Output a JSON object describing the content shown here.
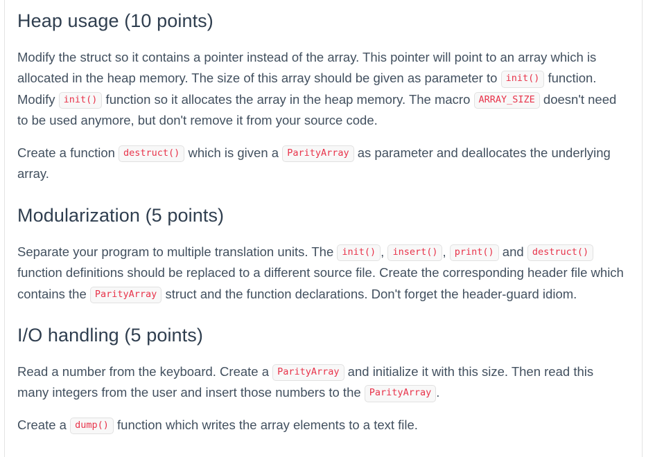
{
  "document": {
    "sections": [
      {
        "id": "heap-usage",
        "heading": "Heap usage (10 points)",
        "paragraphs": [
          {
            "id": "heap-p1",
            "parts": [
              {
                "type": "text",
                "value": "Modify the struct so it contains a pointer instead of the array. This pointer will point to an array which is allocated in the heap memory. The size of this array should be given as parameter to "
              },
              {
                "type": "code",
                "value": "init()"
              },
              {
                "type": "text",
                "value": " function. Modify "
              },
              {
                "type": "code",
                "value": "init()"
              },
              {
                "type": "text",
                "value": " function so it allocates the array in the heap memory. The macro "
              },
              {
                "type": "code",
                "value": "ARRAY_SIZE"
              },
              {
                "type": "text",
                "value": " doesn't need to be used anymore, but don't remove it from your source code."
              }
            ]
          },
          {
            "id": "heap-p2",
            "parts": [
              {
                "type": "text",
                "value": "Create a function "
              },
              {
                "type": "code",
                "value": "destruct()"
              },
              {
                "type": "text",
                "value": " which is given a "
              },
              {
                "type": "code",
                "value": "ParityArray"
              },
              {
                "type": "text",
                "value": " as parameter and deallocates the underlying array."
              }
            ]
          }
        ]
      },
      {
        "id": "modularization",
        "heading": "Modularization (5 points)",
        "paragraphs": [
          {
            "id": "mod-p1",
            "parts": [
              {
                "type": "text",
                "value": "Separate your program to multiple translation units. The "
              },
              {
                "type": "code",
                "value": "init()"
              },
              {
                "type": "text",
                "value": ", "
              },
              {
                "type": "code",
                "value": "insert()"
              },
              {
                "type": "text",
                "value": ", "
              },
              {
                "type": "code",
                "value": "print()"
              },
              {
                "type": "text",
                "value": " and "
              },
              {
                "type": "code",
                "value": "destruct()"
              },
              {
                "type": "text",
                "value": " function definitions should be replaced to a different source file. Create the corresponding header file which contains the "
              },
              {
                "type": "code",
                "value": "ParityArray"
              },
              {
                "type": "text",
                "value": " struct and the function declarations. Don't forget the header-guard idiom."
              }
            ]
          }
        ]
      },
      {
        "id": "io-handling",
        "heading": "I/O handling (5 points)",
        "paragraphs": [
          {
            "id": "io-p1",
            "parts": [
              {
                "type": "text",
                "value": "Read a number from the keyboard. Create a "
              },
              {
                "type": "code",
                "value": "ParityArray"
              },
              {
                "type": "text",
                "value": " and initialize it with this size. Then read this many integers from the user and insert those numbers to the "
              },
              {
                "type": "code",
                "value": "ParityArray"
              },
              {
                "type": "text",
                "value": "."
              }
            ]
          },
          {
            "id": "io-p2",
            "parts": [
              {
                "type": "text",
                "value": "Create a "
              },
              {
                "type": "code",
                "value": "dump()"
              },
              {
                "type": "text",
                "value": " function which writes the array elements to a text file."
              }
            ]
          }
        ]
      }
    ]
  },
  "theme": {
    "heading_color": "#2f3e4f",
    "body_color": "#42505f",
    "code_text_color": "#e8334a",
    "code_bg_color": "#f8f8f8",
    "code_border_color": "#e1e1e1",
    "page_bg": "#ffffff",
    "rule_color": "#e3e3e3"
  }
}
